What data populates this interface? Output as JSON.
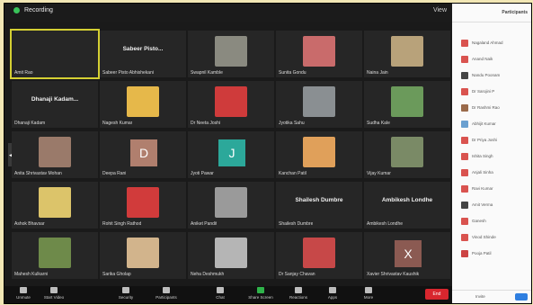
{
  "topbar": {
    "status": "Recording",
    "view_label": "View"
  },
  "participants_panel": {
    "title": "Participants",
    "items": [
      {
        "name": "Nagaland Ahmad"
      },
      {
        "name": "Anand Naik"
      },
      {
        "name": "Nandu Poonam"
      },
      {
        "name": "Dr Sarojini P"
      },
      {
        "name": "Dr Rashmi Rao"
      },
      {
        "name": "Abhijit Kumar"
      },
      {
        "name": "Dr Priya Joshi"
      },
      {
        "name": "Ishita Singh"
      },
      {
        "name": "Anjali Sinha"
      },
      {
        "name": "Ravi Kumar"
      },
      {
        "name": "Amit Verma"
      },
      {
        "name": "Ganesh"
      },
      {
        "name": "Vinod Shinde"
      },
      {
        "name": "Pooja Patil"
      }
    ],
    "footer_invite": "Invite"
  },
  "grid": {
    "tiles": [
      {
        "name": "Amit Rao",
        "big": "",
        "kind": "active"
      },
      {
        "name": "Sabeer Pisto Abhishekani",
        "big": "Sabeer Pisto...",
        "kind": "name"
      },
      {
        "name": "Swapnil Kamble",
        "big": "",
        "kind": "photo",
        "color": "#8a8a80"
      },
      {
        "name": "Sunita Gondu",
        "big": "",
        "kind": "photo",
        "color": "#c96b6b"
      },
      {
        "name": "Naina Jain",
        "big": "",
        "kind": "photo",
        "color": "#b8a27a"
      },
      {
        "name": "Dhanaji Kadam",
        "big": "Dhanaji Kadam...",
        "kind": "name"
      },
      {
        "name": "Nagesh Kumar",
        "big": "",
        "kind": "photo",
        "color": "#e6b84a"
      },
      {
        "name": "Dr Neeta Joshi",
        "big": "",
        "kind": "photo",
        "color": "#cf3b3b"
      },
      {
        "name": "Jyotika Sahu",
        "big": "",
        "kind": "photo",
        "color": "#8a8f92"
      },
      {
        "name": "Sudha Kale",
        "big": "",
        "kind": "photo",
        "color": "#6b9a5b"
      },
      {
        "name": "Anita Shrivastav Mohan",
        "big": "",
        "kind": "photo",
        "color": "#9a7a6a"
      },
      {
        "name": "Deepa Rani",
        "big": "",
        "kind": "avatar",
        "letter": "D",
        "color": "#b07f6e"
      },
      {
        "name": "Jyoti Pawar",
        "big": "",
        "kind": "avatar",
        "letter": "J",
        "color": "#2ca89a"
      },
      {
        "name": "Kanchan Patil",
        "big": "",
        "kind": "photo",
        "color": "#e0a05a"
      },
      {
        "name": "Vijay Kumar",
        "big": "",
        "kind": "photo",
        "color": "#7a8a66"
      },
      {
        "name": "Ashok Bhavsar",
        "big": "",
        "kind": "photo",
        "color": "#dcc46a"
      },
      {
        "name": "Rohit Singh Rathod",
        "big": "",
        "kind": "photo",
        "color": "#d13b3b"
      },
      {
        "name": "Aniket Pandit",
        "big": "",
        "kind": "photo",
        "color": "#9a9a9a"
      },
      {
        "name": "Shailesh Dumbre",
        "big": "Shailesh Dumbre",
        "kind": "name"
      },
      {
        "name": "Ambikesh Londhe",
        "big": "Ambikesh Londhe",
        "kind": "name"
      },
      {
        "name": "Mahesh Kulkarni",
        "big": "",
        "kind": "photo",
        "color": "#6e8a4a"
      },
      {
        "name": "Sarika Gholap",
        "big": "",
        "kind": "photo",
        "color": "#d2b48c"
      },
      {
        "name": "Neha Deshmukh",
        "big": "",
        "kind": "photo",
        "color": "#b5b5b5"
      },
      {
        "name": "Dr Sanjay Chavan",
        "big": "",
        "kind": "photo",
        "color": "#c74848"
      },
      {
        "name": "Xavier Shrivastav Kaushik",
        "big": "",
        "kind": "avatar",
        "letter": "X",
        "color": "#8b5a52"
      }
    ]
  },
  "toolbar": {
    "items": [
      {
        "label": "Unmute"
      },
      {
        "label": "Start Video"
      },
      {
        "label": "Security"
      },
      {
        "label": "Participants"
      },
      {
        "label": "Chat"
      },
      {
        "label": "Share Screen"
      },
      {
        "label": "Reactions"
      },
      {
        "label": "Apps"
      },
      {
        "label": "More"
      }
    ],
    "end_label": "End"
  }
}
